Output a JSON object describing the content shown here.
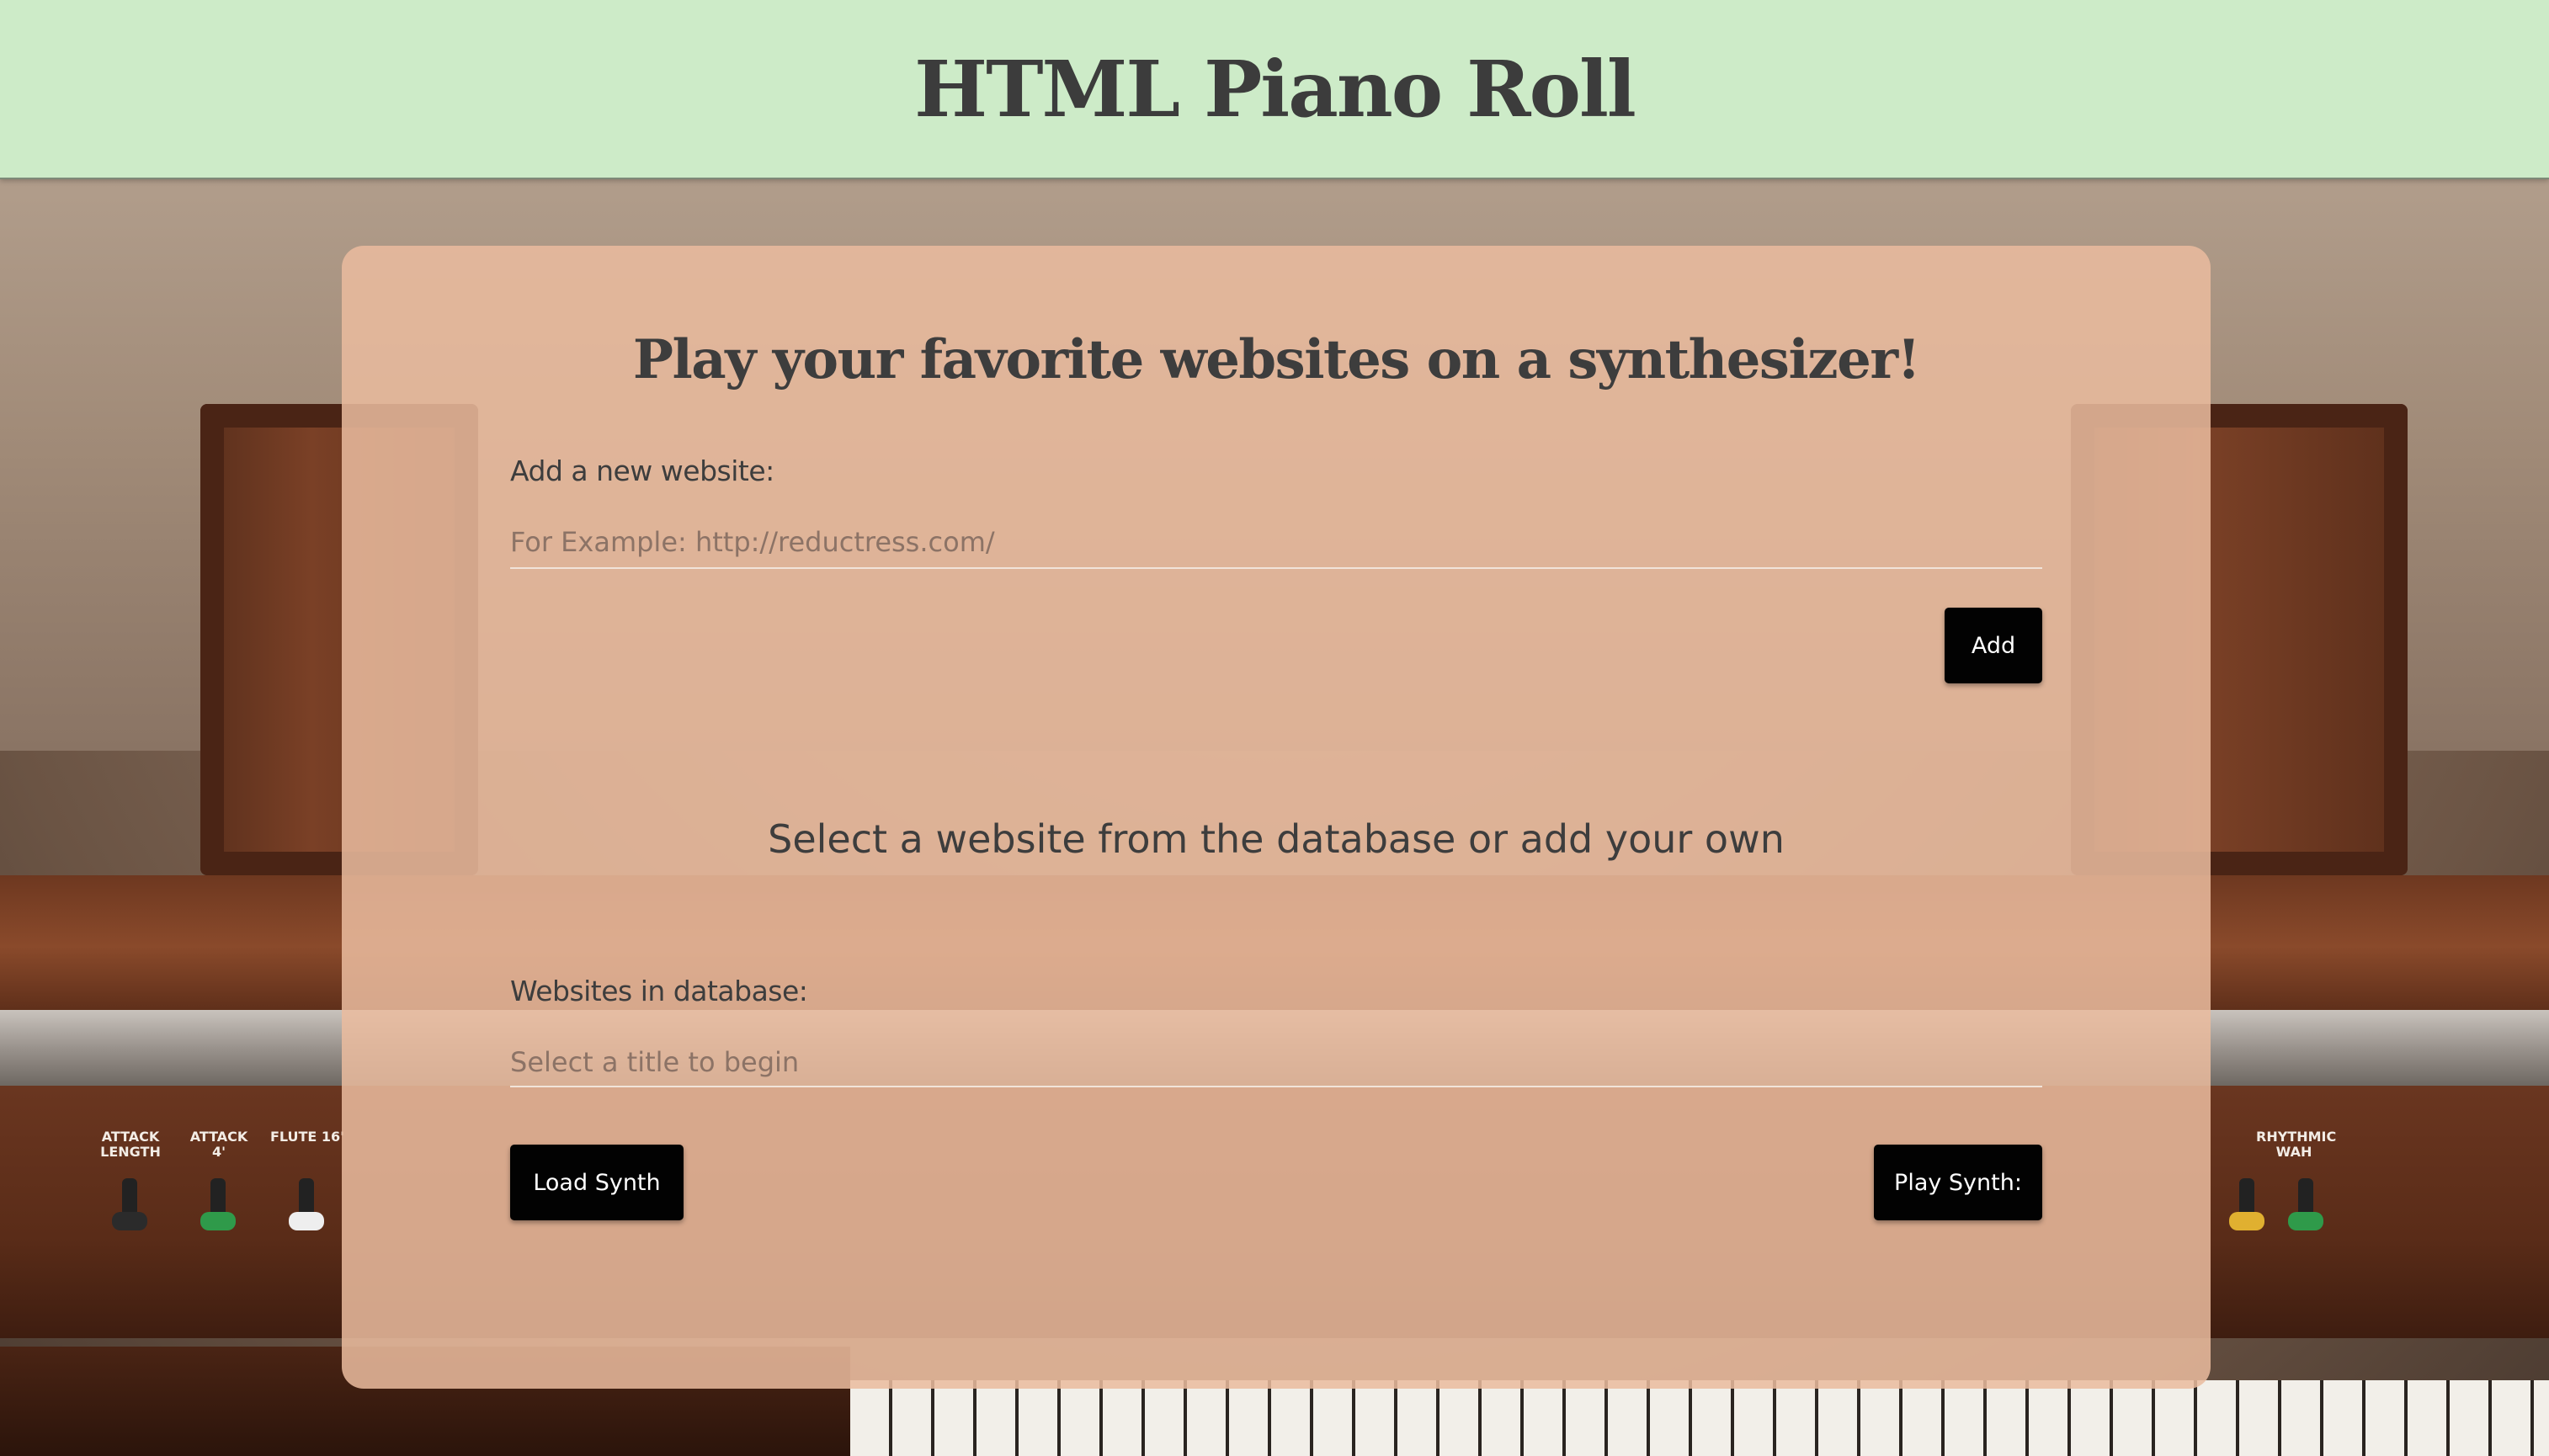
{
  "header": {
    "title": "HTML Piano Roll"
  },
  "main": {
    "headline": "Play your favorite websites on a synthesizer!",
    "add_section": {
      "label": "Add a new website:",
      "input_placeholder": "For Example: http://reductress.com/",
      "input_value": "",
      "add_button": "Add"
    },
    "message": "Select a website from the database or add your own",
    "database_section": {
      "label": "Websites in database:",
      "select_placeholder": "Select a title to begin"
    },
    "load_button": "Load Synth",
    "play_button": "Play Synth:"
  },
  "colors": {
    "header_bg": "#cdebc8",
    "card_bg": "#eabb9e",
    "button_bg": "#020202",
    "text": "#3d3d3d"
  },
  "background": {
    "control_labels": [
      "ATTACK LENGTH",
      "ATTACK 4'",
      "FLUTE 16'",
      "RHYTHMIC WAH"
    ]
  }
}
